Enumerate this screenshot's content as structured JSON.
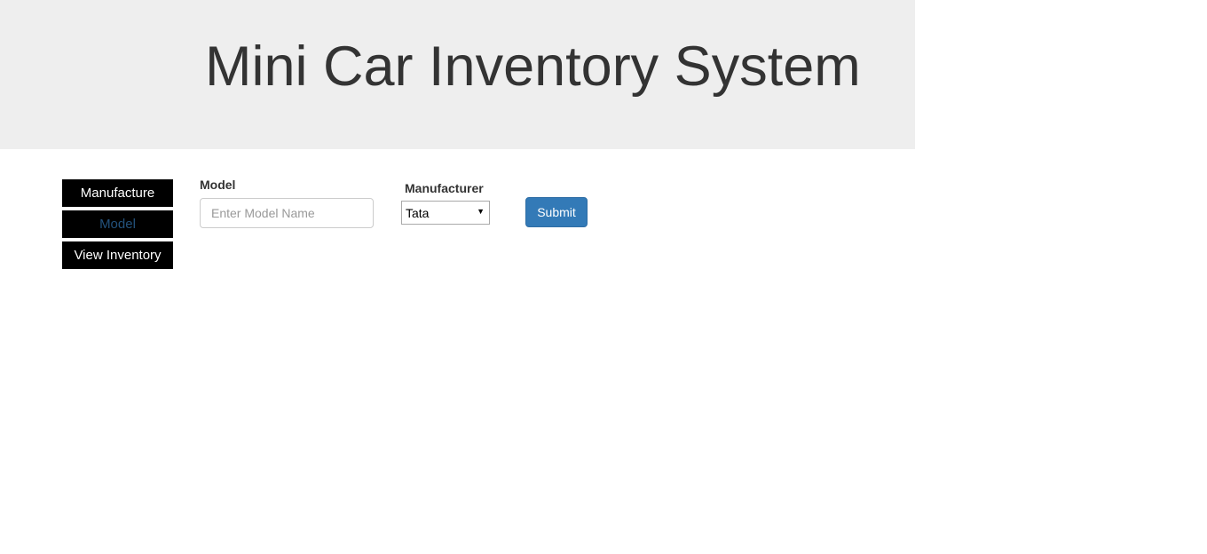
{
  "header": {
    "title": "Mini Car Inventory System"
  },
  "nav": {
    "items": [
      {
        "label": "Manufacture",
        "active": false
      },
      {
        "label": "Model",
        "active": true
      },
      {
        "label": "View Inventory",
        "active": false
      }
    ]
  },
  "form": {
    "model_label": "Model",
    "model_value": "",
    "model_placeholder": "Enter Model Name",
    "manufacturer_label": "Manufacturer",
    "manufacturer_selected": "Tata",
    "submit_label": "Submit"
  },
  "colors": {
    "header_bg": "#eeeeee",
    "nav_bg": "#000000",
    "nav_active_text": "#23527c",
    "primary_button": "#337ab7"
  }
}
